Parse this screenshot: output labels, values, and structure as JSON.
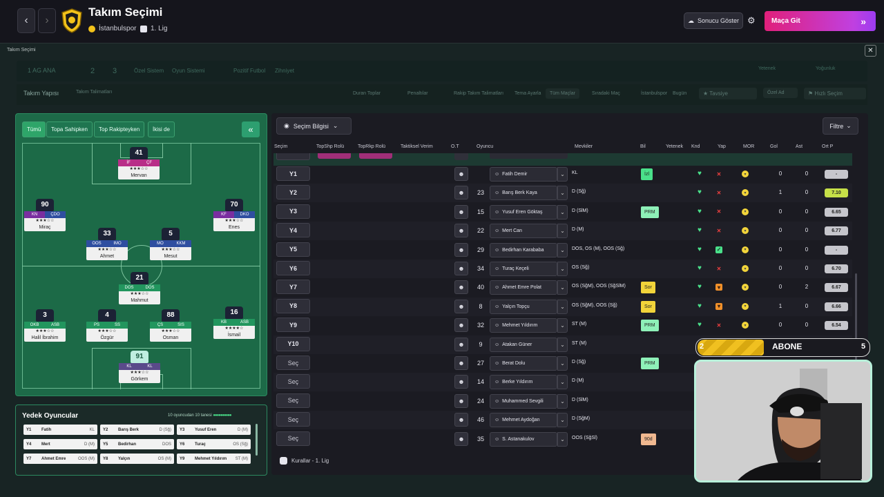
{
  "header": {
    "title": "Takım Seçimi",
    "club": "İstanbulspor",
    "league": "1. Lig",
    "show_result": "Sonucu Göster",
    "go_match": "Maça Git"
  },
  "panel": {
    "title": "Takım Seçimi"
  },
  "filterbar": {
    "formation": "1  AG ANA",
    "b2": "2",
    "b3": "3",
    "ozel": "Özel Sistem",
    "oyun": "Oyun Sistemi",
    "pozitif": "Pozitif Futbol",
    "zihniyet": "Zihniyet",
    "yetenek": "Yetenek",
    "yogunluk": "Yoğunluk"
  },
  "tabsbar": {
    "takim_yapisi": "Takım Yapısı",
    "takim_talimatlari": "Takım Talimatları",
    "duran_toplar": "Duran Toplar",
    "penaltilar": "Penaltılar",
    "rakip": "Rakip Takım Talimatları",
    "tema": "Tema Ayarla",
    "tum_maclar": "Tüm Maçlar",
    "siradaki": "Sıradaki Maç",
    "club_short": "İstanbulspor",
    "bugun": "Bugün",
    "tavsiye": "Tavsiye",
    "ozel_btn": "Özel Ad",
    "hizli": "Hızlı Seçim"
  },
  "pitch_tabs": [
    "Tümü",
    "Topa Sahipken",
    "Top Rakipteyken",
    "İkisi de"
  ],
  "pitch_players": [
    {
      "num": "41",
      "p1": "İF",
      "p2": "ÇF",
      "stars": "★★★☆☆",
      "name": "Mervan",
      "c1": "#b82e88",
      "c2": "#b82e88"
    },
    {
      "num": "90",
      "p1": "KN",
      "p2": "ÇDO",
      "stars": "★★★☆☆",
      "name": "Miraç",
      "c1": "#7a2ea0",
      "c2": "#2f4ea0"
    },
    {
      "num": "70",
      "p1": "KF",
      "p2": "DKO",
      "stars": "★★★☆☆",
      "name": "Enes",
      "c1": "#7a2ea0",
      "c2": "#2f4ea0"
    },
    {
      "num": "33",
      "p1": "OOS",
      "p2": "IMO",
      "stars": "★★★☆☆",
      "name": "Ahmet",
      "c1": "#2f4ea0",
      "c2": "#2f4ea0"
    },
    {
      "num": "5",
      "p1": "MO",
      "p2": "KKM",
      "stars": "★★★☆☆",
      "name": "Mesut",
      "c1": "#2f4ea0",
      "c2": "#2f4ea0"
    },
    {
      "num": "21",
      "p1": "DOS",
      "p2": "DOS",
      "stars": "★★★☆☆",
      "name": "Mahmut",
      "c1": "#22965e",
      "c2": "#22965e"
    },
    {
      "num": "3",
      "p1": "OKB",
      "p2": "ASB",
      "stars": "★★★☆☆",
      "name": "Halil İbrahim",
      "c1": "#22965e",
      "c2": "#22965e"
    },
    {
      "num": "4",
      "p1": "PS",
      "p2": "SS",
      "stars": "★★★☆☆",
      "name": "Özgür",
      "c1": "#22965e",
      "c2": "#22965e"
    },
    {
      "num": "88",
      "p1": "ÇS",
      "p2": "SIS",
      "stars": "★★★☆☆",
      "name": "Osman",
      "c1": "#22965e",
      "c2": "#22965e"
    },
    {
      "num": "16",
      "p1": "KB",
      "p2": "ASB",
      "stars": "★★★★☆",
      "name": "İsmail",
      "c1": "#22965e",
      "c2": "#22965e"
    },
    {
      "num": "91",
      "p1": "KL",
      "p2": "KL",
      "stars": "★★★☆☆",
      "name": "Görkem",
      "c1": "#5a4a8a",
      "c2": "#5a4a8a"
    }
  ],
  "subs": {
    "title": "Yedek Oyuncular",
    "count": "10 oyuncudan 10 tanesi",
    "cells": [
      {
        "slot": "Y1",
        "name": "Fatih",
        "pos": "KL"
      },
      {
        "slot": "Y2",
        "name": "Barış Berk",
        "pos": "D (Sğ)"
      },
      {
        "slot": "Y3",
        "name": "Yusuf Eren",
        "pos": "D (M)"
      },
      {
        "slot": "Y4",
        "name": "Mert",
        "pos": "D (M)"
      },
      {
        "slot": "Y5",
        "name": "Bedirhan",
        "pos": "DOS"
      },
      {
        "slot": "Y6",
        "name": "Turaç",
        "pos": "OS (Sğ)"
      },
      {
        "slot": "Y7",
        "name": "Ahmet Emre",
        "pos": "OOS (M)"
      },
      {
        "slot": "Y8",
        "name": "Yalçın",
        "pos": "OS (M)"
      },
      {
        "slot": "Y9",
        "name": "Mehmet Yıldırım",
        "pos": "ST (M)"
      }
    ]
  },
  "table": {
    "secim_bilgisi": "Seçim Bilgisi",
    "filtre": "Filtre",
    "headers": [
      "Seçim",
      "TopShp Rolü",
      "TopRkp Rolü",
      "Taktiksel Verim",
      "O.T",
      "Oyuncu",
      "Mevkiler",
      "Bil",
      "Yetenek",
      "Knd",
      "Yap",
      "MOR",
      "Gol",
      "Ast",
      "Ort P"
    ],
    "rows": [
      {
        "slot": "Y1",
        "num": "",
        "player": "Fatih Demir",
        "pos": "KL",
        "bill": "İzl",
        "billc": "#4ae08a",
        "yap": "x",
        "gol": "0",
        "ast": "0",
        "rat": "-",
        "hi": false
      },
      {
        "slot": "Y2",
        "num": "23",
        "player": "Barış Berk Kaya",
        "pos": "D (Sğ)",
        "bill": "",
        "billc": "",
        "yap": "x",
        "gol": "1",
        "ast": "0",
        "rat": "7.10",
        "hi": true
      },
      {
        "slot": "Y3",
        "num": "15",
        "player": "Yusuf Eren Göktaş",
        "pos": "D (SlM)",
        "bill": "PRM",
        "billc": "#8ef0b8",
        "yap": "x",
        "gol": "0",
        "ast": "0",
        "rat": "6.65",
        "hi": false
      },
      {
        "slot": "Y4",
        "num": "22",
        "player": "Mert Can",
        "pos": "D (M)",
        "bill": "",
        "billc": "",
        "yap": "x",
        "gol": "0",
        "ast": "0",
        "rat": "6.77",
        "hi": false
      },
      {
        "slot": "Y5",
        "num": "29",
        "player": "Bedirhan Karababa",
        "pos": "DOS, OS (M), OOS (Sğ)",
        "bill": "",
        "billc": "",
        "yap": "v",
        "gol": "0",
        "ast": "0",
        "rat": "-",
        "hi": false
      },
      {
        "slot": "Y6",
        "num": "34",
        "player": "Turaç Keçeli",
        "pos": "OS (Sğ)",
        "bill": "",
        "billc": "",
        "yap": "x",
        "gol": "0",
        "ast": "0",
        "rat": "6.70",
        "hi": false
      },
      {
        "slot": "Y7",
        "num": "40",
        "player": "Ahmet Emre Polat",
        "pos": "OS (SğM), OOS (SğSlM)",
        "bill": "Sor",
        "billc": "#f2d43a",
        "yap": "o",
        "gol": "0",
        "ast": "2",
        "rat": "6.67",
        "hi": false
      },
      {
        "slot": "Y8",
        "num": "8",
        "player": "Yalçın Topçu",
        "pos": "OS (SğM), OOS (Sğ)",
        "bill": "Sor",
        "billc": "#f2d43a",
        "yap": "o",
        "gol": "1",
        "ast": "0",
        "rat": "6.66",
        "hi": false
      },
      {
        "slot": "Y9",
        "num": "32",
        "player": "Mehmet Yıldırım",
        "pos": "ST (M)",
        "bill": "PRM",
        "billc": "#8ef0b8",
        "yap": "x",
        "gol": "0",
        "ast": "0",
        "rat": "6.54",
        "hi": false
      },
      {
        "slot": "Y10",
        "num": "9",
        "player": "Atakan Güner",
        "pos": "ST (M)",
        "bill": "",
        "billc": "",
        "yap": "",
        "gol": "0",
        "ast": "0",
        "rat": "6.55",
        "hi": false
      },
      {
        "slot": "Seç",
        "num": "27",
        "player": "Berat Dolu",
        "pos": "D (Sğ)",
        "bill": "PRM",
        "billc": "#8ef0b8",
        "yap": "",
        "gol": "",
        "ast": "",
        "rat": "",
        "hi": false
      },
      {
        "slot": "Seç",
        "num": "14",
        "player": "Berke Yıldırım",
        "pos": "D (M)",
        "bill": "",
        "billc": "",
        "yap": "",
        "gol": "",
        "ast": "",
        "rat": "",
        "hi": false
      },
      {
        "slot": "Seç",
        "num": "24",
        "player": "Muhammed Sevgili",
        "pos": "D (SlM)",
        "bill": "",
        "billc": "",
        "yap": "",
        "gol": "",
        "ast": "",
        "rat": "",
        "hi": false
      },
      {
        "slot": "Seç",
        "num": "46",
        "player": "Mehmet Aydoğan",
        "pos": "D (SğM)",
        "bill": "",
        "billc": "",
        "yap": "",
        "gol": "",
        "ast": "",
        "rat": "",
        "hi": false
      },
      {
        "slot": "Seç",
        "num": "35",
        "player": "S. Astanakulov",
        "pos": "OOS (SğSl)",
        "bill": "90d",
        "billc": "#f0b890",
        "yap": "",
        "gol": "",
        "ast": "",
        "rat": "",
        "hi": false
      }
    ],
    "footer": "Kurallar - 1. Lig"
  },
  "overlay": {
    "left": "2",
    "text": "ABONE",
    "right": "5"
  }
}
